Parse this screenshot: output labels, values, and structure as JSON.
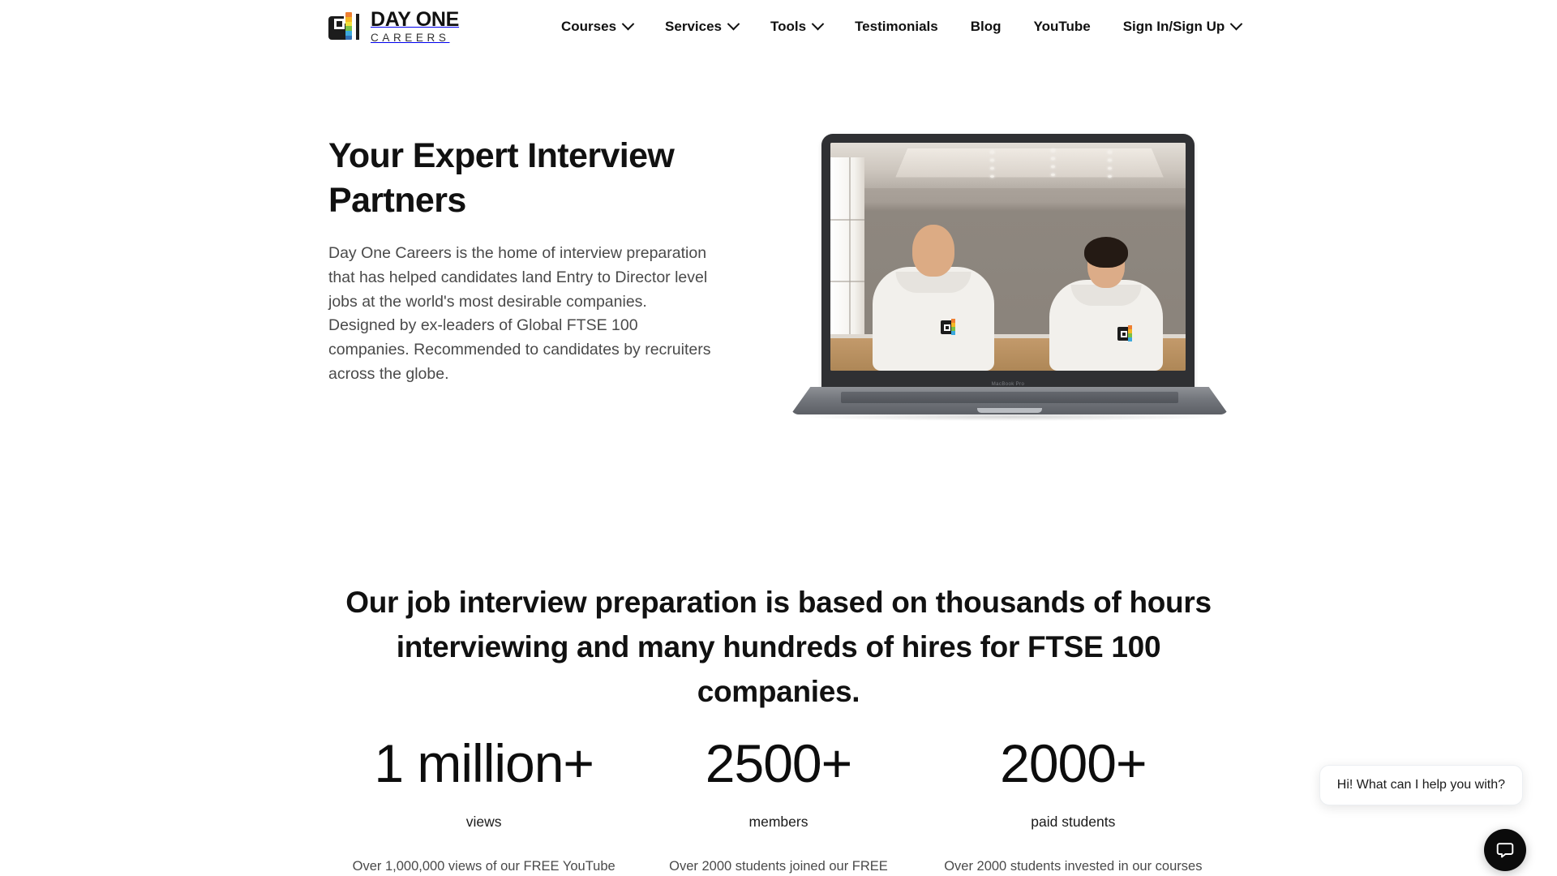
{
  "header": {
    "logo": {
      "icon_name": "day-one-careers-logo-mark",
      "primary_text": "DAY ONE",
      "secondary_text": "CAREERS",
      "stripe_colors": [
        "#ef7f31",
        "#f4b724",
        "#f2e03a",
        "#7ac143",
        "#3ca9dd",
        "#2f6fb5"
      ],
      "mark_color": "#1c1c1c"
    },
    "nav": [
      {
        "label": "Courses",
        "has_dropdown": true
      },
      {
        "label": "Services",
        "has_dropdown": true
      },
      {
        "label": "Tools",
        "has_dropdown": true
      },
      {
        "label": "Testimonials",
        "has_dropdown": false
      },
      {
        "label": "Blog",
        "has_dropdown": false
      },
      {
        "label": "YouTube",
        "has_dropdown": false
      },
      {
        "label": "Sign In/Sign Up",
        "has_dropdown": true
      }
    ]
  },
  "hero": {
    "title": "Your Expert Interview Partners",
    "paragraph": "Day One Careers is the home of interview preparation that has helped candidates land Entry to Director level jobs at the world's most desirable companies. Designed by ex-leaders of Global FTSE 100 companies. Recommended to candidates by recruiters across the globe.",
    "image": {
      "name": "laptop-video-still",
      "device_label": "MacBook Pro",
      "description": "Two presenters in white Day One Careers hoodies on a laptop screen"
    }
  },
  "stats_section": {
    "heading": "Our job interview preparation is based on thousands of hours interviewing and many hundreds of hires for FTSE 100 companies.",
    "stats": [
      {
        "number": "1 million+",
        "label": "views",
        "description": "Over 1,000,000 views of our FREE YouTube"
      },
      {
        "number": "2500+",
        "label": "members",
        "description": "Over 2000 students joined our FREE"
      },
      {
        "number": "2000+",
        "label": "paid students",
        "description": "Over 2000 students invested in our courses"
      }
    ]
  },
  "chat_widget": {
    "greeting": "Hi! What can I help you with?",
    "button_icon": "chat-bubble-icon",
    "button_color": "#0b0b0b"
  }
}
